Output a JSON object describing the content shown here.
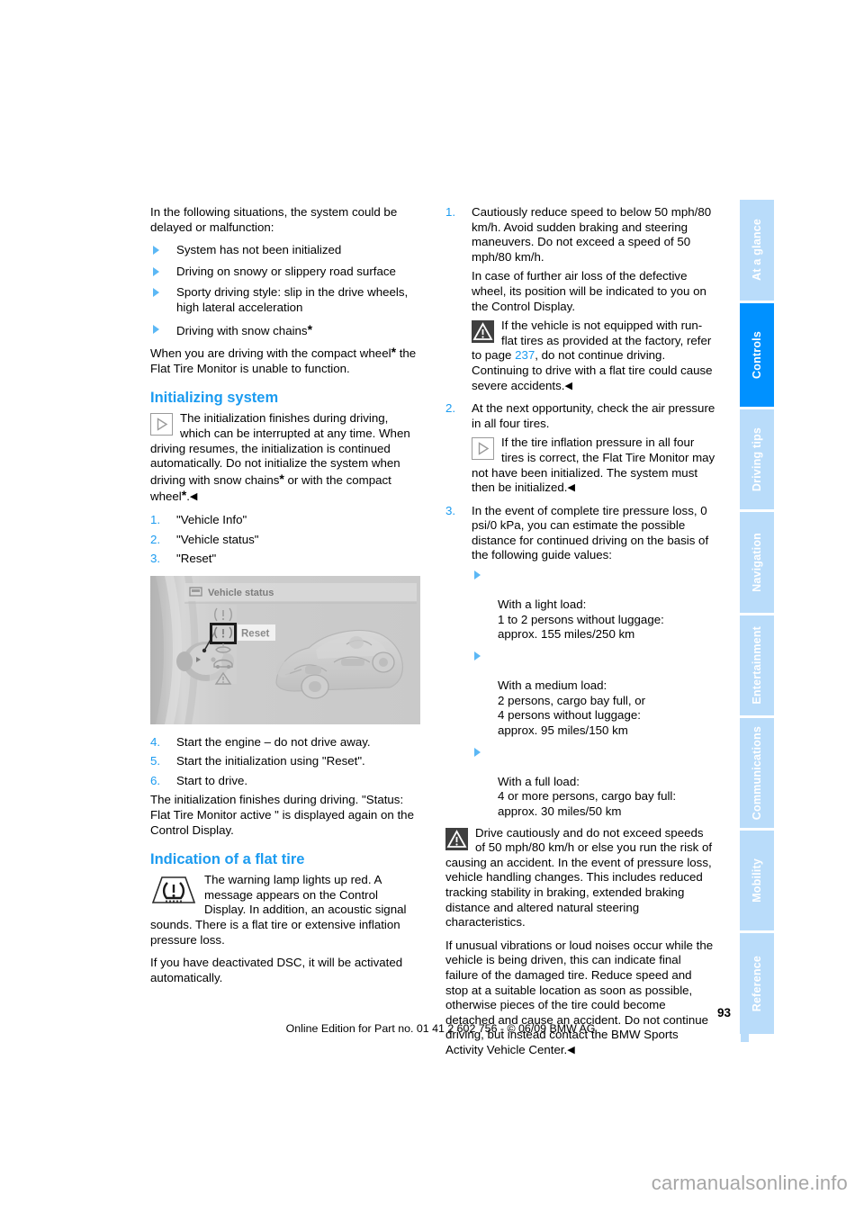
{
  "document": {
    "page_number": "93",
    "edition_line": "Online Edition for Part no. 01 41 2 602 756 - © 06/09 BMW AG",
    "watermark": "carmanualsonline.info"
  },
  "colors": {
    "heading_blue": "#1b9bf0",
    "tab_active": "#0091ff",
    "tab_inactive": "#b9dcfa",
    "bullet_blue": "#5cb8f5"
  },
  "sidebar": {
    "tabs": [
      {
        "label": "At a glance",
        "active": false
      },
      {
        "label": "Controls",
        "active": true
      },
      {
        "label": "Driving tips",
        "active": false
      },
      {
        "label": "Navigation",
        "active": false
      },
      {
        "label": "Entertainment",
        "active": false
      },
      {
        "label": "Communications",
        "active": false
      },
      {
        "label": "Mobility",
        "active": false
      },
      {
        "label": "Reference",
        "active": false
      }
    ]
  },
  "left_column": {
    "intro": "In the following situations, the system could be delayed or malfunction:",
    "bullets": [
      "System has not been initialized",
      "Driving on snowy or slippery road surface",
      "Sporty driving style: slip in the drive wheels, high lateral acceleration",
      "Driving with snow chains"
    ],
    "bullet_4_star": "*",
    "compact_wheel_para_1": "When you are driving with the compact wheel",
    "compact_wheel_star": "*",
    "compact_wheel_para_2": "the Flat Tire Monitor is unable to function.",
    "heading_initializing": "Initializing system",
    "note_initializing_1": "The initialization finishes during driving, which can be interrupted at any time. When driving resumes, the initialization is continued automatically. Do not initialize the system when driving with snow chains",
    "note_initializing_star1": "*",
    "note_initializing_2": " or with the compact wheel",
    "note_initializing_star2": "*",
    "note_initializing_3": ".",
    "steps_a": [
      {
        "num": "1.",
        "text": "\"Vehicle Info\""
      },
      {
        "num": "2.",
        "text": "\"Vehicle status\""
      },
      {
        "num": "3.",
        "text": "\"Reset\""
      }
    ],
    "illustration": {
      "title": "Vehicle status",
      "button_label": "Reset",
      "alt": "iDrive Control Display showing Vehicle status menu with tire pressure reset highlighted and a ghosted vehicle graphic"
    },
    "steps_b": [
      {
        "num": "4.",
        "text": "Start the engine – do not drive away."
      },
      {
        "num": "5.",
        "text": "Start the initialization using \"Reset\"."
      },
      {
        "num": "6.",
        "text": "Start to drive."
      }
    ],
    "after_steps": "The initialization finishes during driving. \"Status: Flat Tire Monitor active \" is displayed again on the Control Display.",
    "heading_indication": "Indication of a flat tire",
    "lamp_para": "The warning lamp lights up red. A message appears on the Control Display. In addition, an acoustic signal sounds. There is a flat tire or extensive inflation pressure loss.",
    "dsc_para": "If you have deactivated DSC, it will be activated automatically."
  },
  "right_column": {
    "step_1": {
      "num": "1.",
      "text": "Cautiously reduce speed to below 50 mph/80 km/h. Avoid sudden braking and steering maneuvers. Do not exceed a speed of 50 mph/80 km/h.",
      "text2": "In case of further air loss of the defective wheel, its position will be indicated to you on the Control Display."
    },
    "warning_1_a": "If the vehicle is not equipped with run-flat tires as provided at the factory, refer to page ",
    "warning_1_ref": "237",
    "warning_1_b": ", do not continue driving. Continuing to drive with a flat tire could cause severe accidents.",
    "step_2": {
      "num": "2.",
      "text": "At the next opportunity, check the air pressure in all four tires."
    },
    "note_2": "If the tire inflation pressure in all four tires is correct, the Flat Tire Monitor may not have been initialized. The system must then be initialized.",
    "step_3": {
      "num": "3.",
      "text": "In the event of complete tire pressure loss, 0 psi/0 kPa, you can estimate the possible distance for continued driving on the basis of the following guide values:"
    },
    "load_bullets": [
      "With a light load:\n1 to 2 persons without luggage:\napprox. 155 miles/250 km",
      "With a medium load:\n2 persons, cargo bay full, or\n4 persons without luggage:\napprox. 95 miles/150 km",
      "With a full load:\n4 or more persons, cargo bay full:\napprox. 30 miles/50 km"
    ],
    "warning_2": "Drive cautiously and do not exceed speeds of 50 mph/80 km/h or else you run the risk of causing an accident. In the event of pressure loss, vehicle handling changes. This includes reduced tracking stability in braking, extended braking distance and altered natural steering characteristics.",
    "warning_2_cont": "If unusual vibrations or loud noises occur while the vehicle is being driven, this can indicate final failure of the damaged tire. Reduce speed and stop at a suitable location as soon as possible, otherwise pieces of the tire could become detached and cause an accident. Do not continue driving, but instead contact the BMW Sports Activity Vehicle Center."
  }
}
